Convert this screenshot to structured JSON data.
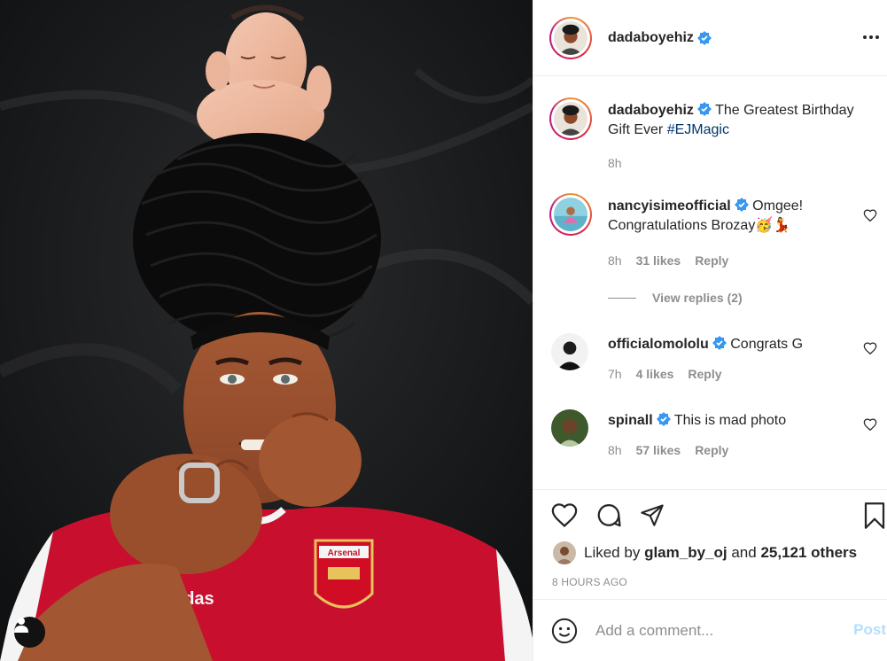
{
  "post": {
    "author": "dadaboyehiz",
    "more_icon": "more-horizontal-icon",
    "caption": {
      "username": "dadaboyehiz",
      "text": "The Greatest Birthday Gift Ever",
      "hashtag": "#EJMagic",
      "age": "8h"
    },
    "comments": [
      {
        "username": "nancyisimeofficial",
        "text": "Omgee! Congratulations Brozay🥳💃",
        "age": "8h",
        "likes": "31 likes",
        "reply": "Reply",
        "view_replies": "View replies (2)"
      },
      {
        "username": "officialomololu",
        "text": "Congrats G",
        "age": "7h",
        "likes": "4 likes",
        "reply": "Reply"
      },
      {
        "username": "spinall",
        "text": "This is mad photo",
        "age": "8h",
        "likes": "57 likes",
        "reply": "Reply"
      }
    ],
    "liked_by": {
      "prefix": "Liked by",
      "user": "glam_by_oj",
      "connector": "and",
      "others": "25,121 others"
    },
    "time_ago": "8 HOURS AGO",
    "add_comment": {
      "placeholder": "Add a comment...",
      "post_label": "Post"
    }
  },
  "icons": {
    "verified": "verified-badge-icon",
    "like": "heart-icon",
    "comment": "comment-icon",
    "share": "paper-plane-icon",
    "save": "bookmark-icon",
    "emoji": "smiley-icon",
    "tag": "user-tag-icon"
  },
  "colors": {
    "verified": "#3897f0",
    "text": "#262626",
    "secondary": "#8e8e8e",
    "hashtag": "#00376b",
    "post_disabled": "#b2dffc"
  }
}
